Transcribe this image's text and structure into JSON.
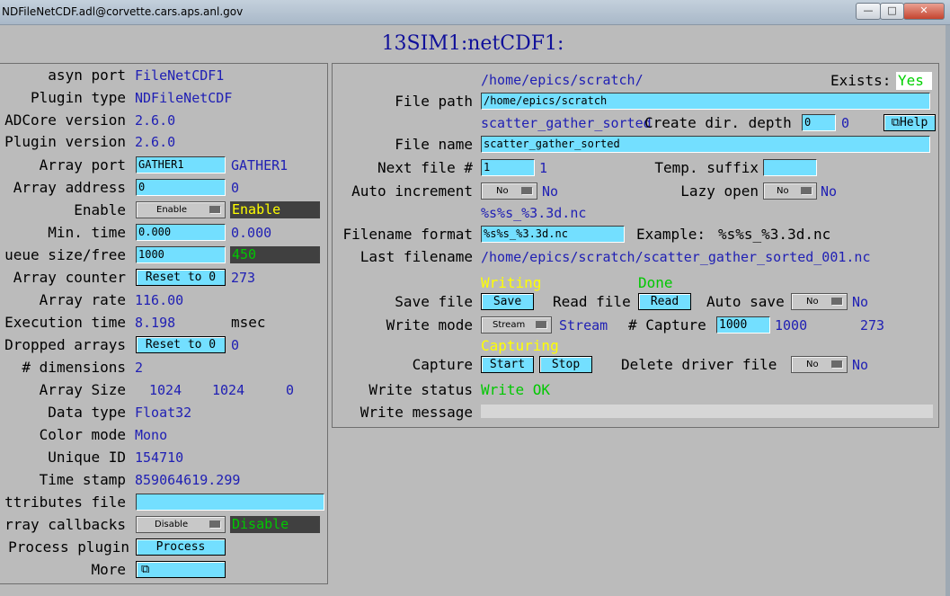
{
  "window": {
    "title": "NDFileNetCDF.adl@corvette.cars.aps.anl.gov",
    "minimize": "—",
    "maximize": "□",
    "close": "✕"
  },
  "heading": "13SIM1:netCDF1:",
  "left": {
    "asyn_port_label": "asyn port",
    "asyn_port_value": "FileNetCDF1",
    "plugin_type_label": "Plugin type",
    "plugin_type_value": "NDFileNetCDF",
    "adcore_label": "ADCore version",
    "adcore_value": "2.6.0",
    "plugin_version_label": "Plugin version",
    "plugin_version_value": "2.6.0",
    "array_port_label": "Array port",
    "array_port_input": "GATHER1",
    "array_port_readback": "GATHER1",
    "array_address_label": "Array address",
    "array_address_input": "0",
    "array_address_readback": "0",
    "enable_label": "Enable",
    "enable_menu": "Enable",
    "enable_readback": "Enable",
    "min_time_label": "Min. time",
    "min_time_input": "0.000",
    "min_time_readback": "0.000",
    "queue_label": "ueue size/free",
    "queue_input": "1000",
    "queue_readback": "450",
    "array_counter_label": "Array counter",
    "array_counter_button": "Reset to 0",
    "array_counter_value": "273",
    "array_rate_label": "Array rate",
    "array_rate_value": "116.00",
    "exec_time_label": "Execution time",
    "exec_time_value": "8.198",
    "exec_time_unit": "msec",
    "dropped_label": "Dropped arrays",
    "dropped_button": "Reset to 0",
    "dropped_value": "0",
    "ndims_label": "# dimensions",
    "ndims_value": "2",
    "array_size_label": "Array Size",
    "array_size_0": "1024",
    "array_size_1": "1024",
    "array_size_2": "0",
    "data_type_label": "Data type",
    "data_type_value": "Float32",
    "color_mode_label": "Color mode",
    "color_mode_value": "Mono",
    "unique_id_label": "Unique ID",
    "unique_id_value": "154710",
    "time_stamp_label": "Time stamp",
    "time_stamp_value": "859064619.299",
    "attributes_label": "ttributes file",
    "attributes_input": "",
    "callbacks_label": "rray callbacks",
    "callbacks_menu": "Disable",
    "callbacks_readback": "Disable",
    "process_label": "Process plugin",
    "process_button": "Process",
    "more_label": "More",
    "more_button": "⧉"
  },
  "right": {
    "file_path_readback": "/home/epics/scratch/",
    "exists_label": "Exists:",
    "exists_value": "Yes",
    "file_path_label": "File path",
    "file_path_input": "/home/epics/scratch",
    "file_name_readback": "scatter_gather_sorted",
    "create_dir_label": "Create dir. depth",
    "create_dir_input": "0",
    "create_dir_value": "0",
    "help_button": "⧉Help",
    "file_name_label": "File name",
    "file_name_input": "scatter_gather_sorted",
    "next_file_label": "Next file #",
    "next_file_input": "1",
    "next_file_value": "1",
    "temp_suffix_label": "Temp. suffix",
    "temp_suffix_input": "",
    "auto_inc_label": "Auto increment",
    "auto_inc_menu": "No",
    "auto_inc_value": "No",
    "lazy_open_label": "Lazy open",
    "lazy_open_menu": "No",
    "lazy_open_value": "No",
    "format_readback": "%s%s_%3.3d.nc",
    "format_label": "Filename format",
    "format_input": "%s%s_%3.3d.nc",
    "example_label": "Example:",
    "example_value": "%s%s_%3.3d.nc",
    "last_file_label": "Last filename",
    "last_file_value": "/home/epics/scratch/scatter_gather_sorted_001.nc",
    "writing_status": "Writing",
    "done_status": "Done",
    "save_file_label": "Save file",
    "save_button": "Save",
    "read_file_label": "Read file",
    "read_button": "Read",
    "auto_save_label": "Auto save",
    "auto_save_menu": "No",
    "auto_save_value": "No",
    "write_mode_label": "Write mode",
    "write_mode_menu": "Stream",
    "write_mode_value": "Stream",
    "capture_num_label": "# Capture",
    "capture_num_input": "1000",
    "capture_num_value": "1000",
    "captured_value": "273",
    "capturing_status": "Capturing",
    "capture_label": "Capture",
    "start_button": "Start",
    "stop_button": "Stop",
    "delete_label": "Delete driver file",
    "delete_menu": "No",
    "delete_value": "No",
    "write_status_label": "Write status",
    "write_status_value": "Write OK",
    "write_message_label": "Write message",
    "write_message_value": ""
  }
}
